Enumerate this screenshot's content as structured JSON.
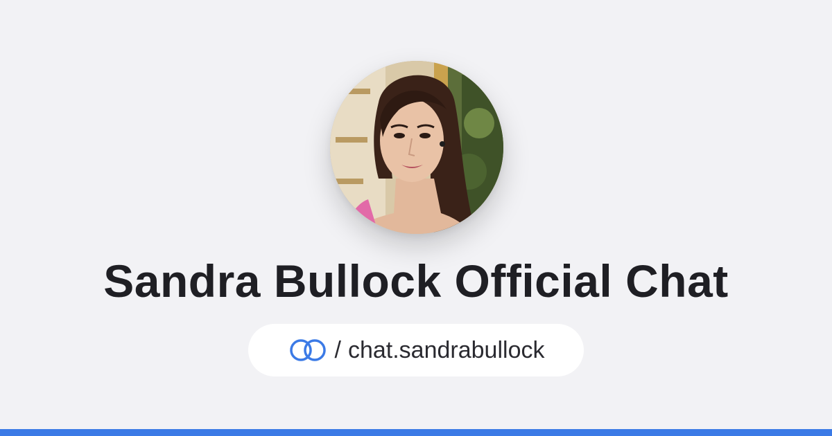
{
  "profile": {
    "avatar_icon": "profile-photo",
    "title": "Sandra Bullock Official Chat"
  },
  "link": {
    "logo_icon": "interlocked-rings-icon",
    "separator": "/",
    "handle": "chat.sandrabullock"
  },
  "colors": {
    "background": "#f2f2f5",
    "accent": "#3b7ae6",
    "title_text": "#1f1f24",
    "pill_background": "#ffffff"
  }
}
